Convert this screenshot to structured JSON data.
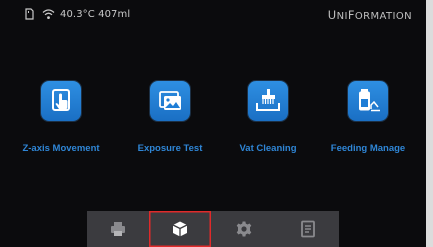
{
  "status_bar": {
    "readout": "40.3°C 407ml",
    "icons": [
      "sd-card-icon",
      "wifi-icon"
    ]
  },
  "brand": {
    "parts": [
      "U",
      "NI",
      "F",
      "ORMATION"
    ]
  },
  "apps": [
    {
      "label": "Z-axis Movement",
      "icon": "touch-hand-icon"
    },
    {
      "label": "Exposure Test",
      "icon": "image-stack-icon"
    },
    {
      "label": "Vat Cleaning",
      "icon": "vat-brush-icon"
    },
    {
      "label": "Feeding Manage",
      "icon": "resin-bottle-icon"
    }
  ],
  "bottom_nav": {
    "items": [
      "printer-icon",
      "cube-tools-icon",
      "gear-icon",
      "info-doc-icon"
    ],
    "active": "cube-tools-icon"
  },
  "colors": {
    "accent": "#1f7ed6",
    "label": "#2f86d6",
    "screen_bg": "#0b0b0d",
    "nav_bg": "#3b3b3f",
    "highlight": "#e02a2a"
  }
}
